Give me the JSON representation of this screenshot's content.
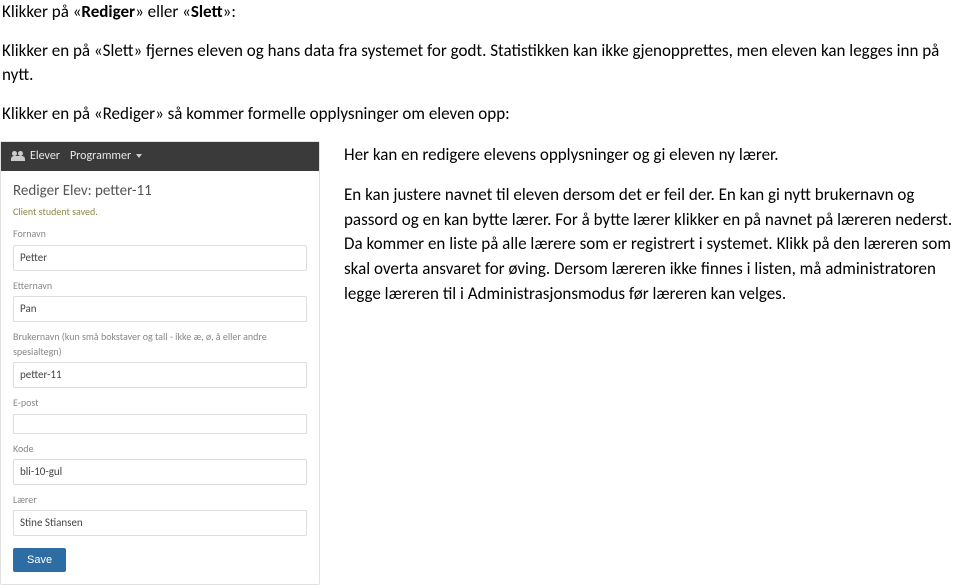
{
  "intro": {
    "p1_prefix": "Klikker på «",
    "p1_b1": "Rediger",
    "p1_mid": "» eller «",
    "p1_b2": "Slett",
    "p1_suffix": "»:",
    "p2": "Klikker en på «Slett» fjernes eleven og hans data fra systemet for godt. Statistikken kan ikke gjenopprettes, men eleven kan legges inn på nytt.",
    "p3": "Klikker en på «Rediger» så kommer formelle opplysninger om eleven opp:"
  },
  "form": {
    "nav": {
      "elever": "Elever",
      "programmer": "Programmer"
    },
    "title": "Rediger Elev: petter-11",
    "flash": "Client student saved.",
    "labels": {
      "fornavn": "Fornavn",
      "etternavn": "Etternavn",
      "brukernavn": "Brukernavn (kun små bokstaver og tall - ikke æ, ø, å eller andre spesialtegn)",
      "epost": "E-post",
      "kode": "Kode",
      "laerer": "Lærer"
    },
    "values": {
      "fornavn": "Petter",
      "etternavn": "Pan",
      "brukernavn": "petter-11",
      "epost": "",
      "kode": "bli-10-gul",
      "laerer": "Stine Stiansen"
    },
    "save": "Save"
  },
  "right": {
    "p1": "Her kan en redigere elevens opplysninger og gi eleven ny lærer.",
    "p2": "En kan justere navnet til eleven dersom det er feil der. En kan gi nytt brukernavn og passord og en kan bytte lærer. For å bytte lærer klikker en på navnet på læreren nederst. Da kommer en liste på alle lærere som er registrert i systemet. Klikk på den læreren som skal overta ansvaret for øving. Dersom læreren ikke finnes i listen, må administratoren legge læreren til i Administrasjonsmodus før læreren kan velges."
  }
}
